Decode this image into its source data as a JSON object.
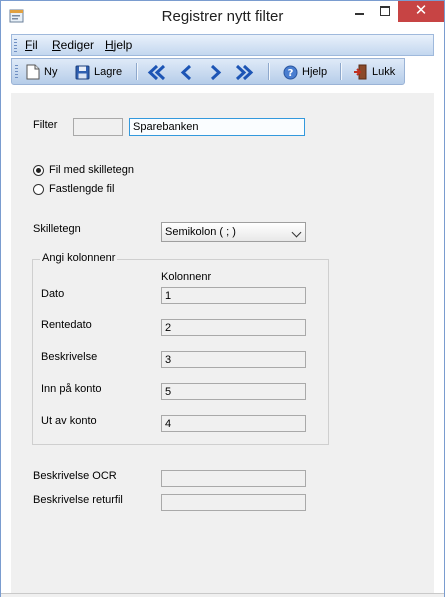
{
  "window": {
    "title": "Registrer nytt filter"
  },
  "menu": [
    {
      "label": "Fil",
      "mnemonic": "F",
      "rest": "il"
    },
    {
      "label": "Rediger",
      "mnemonic": "R",
      "rest": "ediger"
    },
    {
      "label": "Hjelp",
      "mnemonic": "H",
      "rest": "jelp"
    }
  ],
  "toolbar": {
    "new_label": "Ny",
    "save_label": "Lagre",
    "help_label": "Hjelp",
    "close_label": "Lukk"
  },
  "form": {
    "filter_label": "Filter",
    "filter_code": "",
    "filter_name": "Sparebanken",
    "radio_delimited": "Fil med skilletegn",
    "radio_fixed": "Fastlengde fil",
    "selected_format": "Fil med skilletegn",
    "delimiter_label": "Skilletegn",
    "delimiter_value": "Semikolon ( ; )",
    "group_title": "Angi kolonnenr",
    "column_header": "Kolonnenr",
    "columns": [
      {
        "label": "Dato",
        "value": "1"
      },
      {
        "label": "Rentedato",
        "value": "2"
      },
      {
        "label": "Beskrivelse",
        "value": "3"
      },
      {
        "label": "Inn på konto",
        "value": "5"
      },
      {
        "label": "Ut av konto",
        "value": "4"
      }
    ],
    "ocr_label": "Beskrivelse OCR",
    "ocr_value": "",
    "return_label": "Beskrivelse returfil",
    "return_value": ""
  },
  "colors": {
    "accent": "#3399dd",
    "toolbar_bg": "#c3d7ef",
    "close_button": "#c74444"
  }
}
